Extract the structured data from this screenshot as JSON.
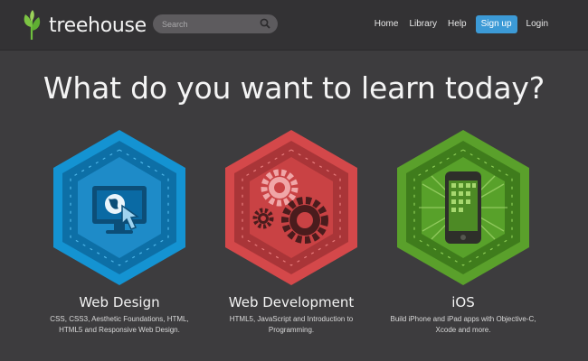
{
  "header": {
    "logo_text": "treehouse",
    "search_placeholder": "Search",
    "nav": {
      "home": "Home",
      "library": "Library",
      "help": "Help",
      "signup": "Sign up",
      "login": "Login"
    }
  },
  "headline": "What do you want to learn today?",
  "cards": [
    {
      "title": "Web Design",
      "description": "CSS, CSS3, Aesthetic Foundations, HTML, HTML5 and Responsive Web Design.",
      "icon": "monitor-globe-cursor-icon",
      "color": "#1a9ad6"
    },
    {
      "title": "Web Development",
      "description": "HTML5, JavaScript and Introduction to Programming.",
      "icon": "gears-icon",
      "color": "#d94a4a"
    },
    {
      "title": "iOS",
      "description": "Build iPhone and iPad apps with Objective-C, Xcode and more.",
      "icon": "iphone-icon",
      "color": "#5ea32e"
    }
  ],
  "colors": {
    "background": "#3d3c3e",
    "header": "#333234",
    "signup": "#3c9ad6"
  }
}
